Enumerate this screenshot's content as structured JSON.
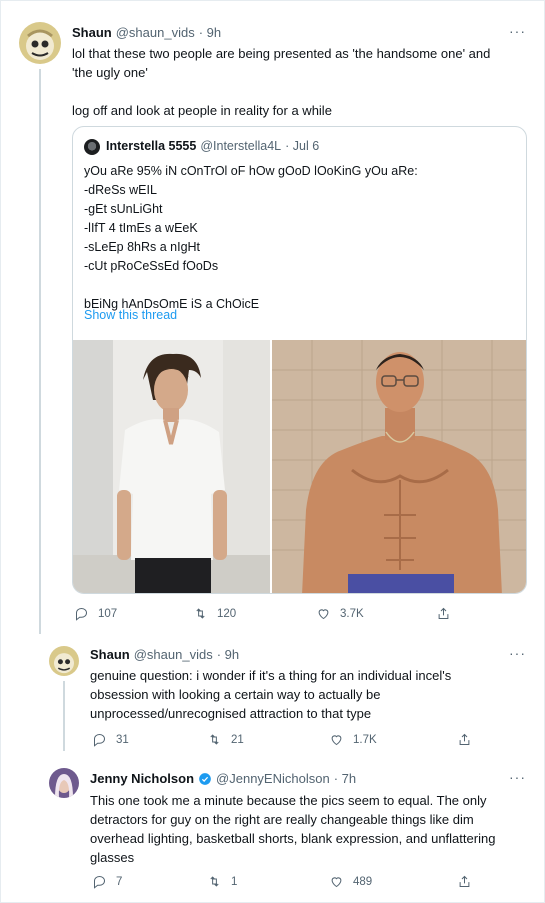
{
  "tweets": [
    {
      "author": "Shaun",
      "handle": "@shaun_vids",
      "time": "· 9h",
      "lines": [
        "lol that these two people are being presented as 'the handsome one' and",
        "'the ugly one'",
        "",
        "log off and look at people in reality for a while"
      ],
      "more": "···",
      "stats": {
        "replies": "107",
        "retweets": "120",
        "likes": "3.7K"
      }
    },
    {
      "author": "Shaun",
      "handle": "@shaun_vids",
      "time": "· 9h",
      "lines": [
        "genuine question: i wonder if it's a thing for an individual incel's",
        "obsession with looking a certain way to actually be",
        "unprocessed/unrecognised attraction to that type"
      ],
      "more": "···",
      "stats": {
        "replies": "31",
        "retweets": "21",
        "likes": "1.7K"
      }
    },
    {
      "author": "Jenny Nicholson",
      "handle": "@JennyENicholson",
      "time": "· 7h",
      "lines": [
        "This one took me a minute because the pics seem to equal. The only",
        "detractors for guy on the right are really changeable things like dim",
        "overhead lighting, basketball shorts, blank expression, and unflattering",
        "glasses"
      ],
      "more": "···",
      "stats": {
        "replies": "7",
        "retweets": "1",
        "likes": "489"
      }
    }
  ],
  "quote": {
    "author": "Interstella 5555",
    "handle": "@Interstella4L",
    "time": "· Jul 6",
    "text": "yOu aRe 95% iN cOnTrOl oF hOw gOoD lOoKinG yOu aRe:\n-dReSs wEIL\n-gEt sUnLiGht\n-lIfT 4 tImEs a wEeK\n-sLeEp 8hRs a nIgHt\n-cUt pRoCeSsEd fOoDs\n\nbEiNg hAnDsOmE iS a ChOicE",
    "show_thread": "Show this thread"
  },
  "icons": {
    "reply": "reply-icon",
    "retweet": "retweet-icon",
    "like": "heart-icon",
    "share": "share-icon",
    "verified": "verified-badge-icon"
  },
  "colors": {
    "link": "#1d9bf0",
    "secondary": "#536471",
    "border": "#cfd9de",
    "verified": "#1d9bf0"
  }
}
